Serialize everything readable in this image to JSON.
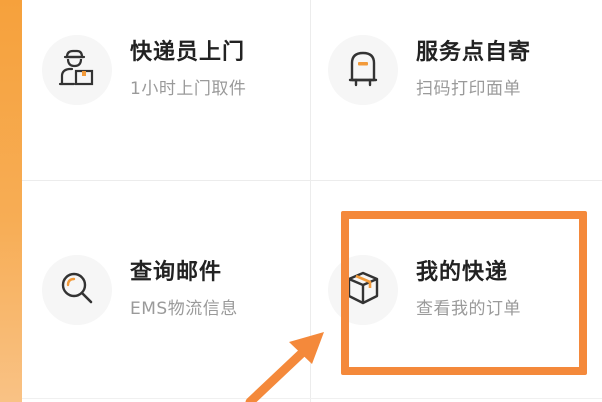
{
  "tiles": [
    {
      "title": "快递员上门",
      "subtitle": "1小时上门取件",
      "icon": "courier-icon"
    },
    {
      "title": "服务点自寄",
      "subtitle": "扫码打印面单",
      "icon": "mailbox-icon"
    },
    {
      "title": "查询邮件",
      "subtitle": "EMS物流信息",
      "icon": "search-icon"
    },
    {
      "title": "我的快递",
      "subtitle": "查看我的订单",
      "icon": "package-icon"
    }
  ],
  "colors": {
    "accent": "#f4893b",
    "icon_orange": "#f29a3a",
    "icon_dark": "#333333",
    "title": "#222222",
    "subtitle": "#9a9a9a",
    "side_band": "#f6a13c"
  }
}
